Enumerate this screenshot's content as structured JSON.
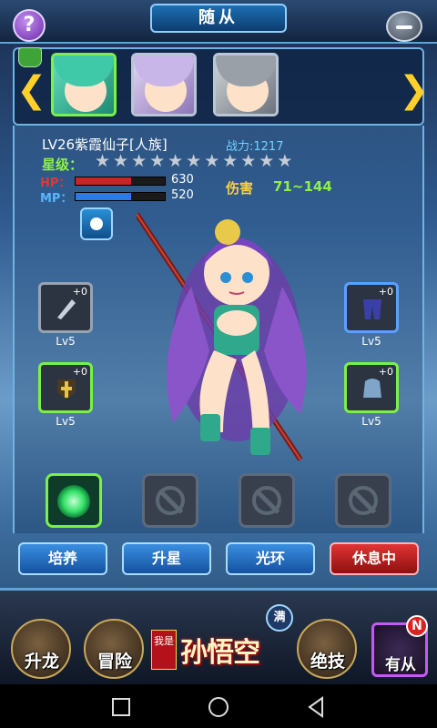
{
  "header": {
    "title": "随从",
    "help_label": "?"
  },
  "roster": {
    "left_arrow": "❮",
    "right_arrow": "❯",
    "portraits": [
      {
        "hair_color": "#3fc9a8",
        "selected": true
      },
      {
        "hair_color": "#c9b6e8",
        "selected": false
      },
      {
        "hair_color": "#9aa0a8",
        "selected": false
      }
    ]
  },
  "companion": {
    "name": "LV26紫霞仙子[人族]",
    "power": "战力:1217",
    "star_label": "星级：",
    "stars": "★★★★★★★★★★★",
    "hp_label": "HP：",
    "hp_value": "630",
    "hp_fraction": 0.62,
    "mp_label": "MP：",
    "mp_value": "520",
    "mp_fraction": 0.62,
    "damage_label": "伤害",
    "damage_value": "71~144"
  },
  "equipment": {
    "weapon": {
      "plus": "+0",
      "level": "Lv5"
    },
    "armor": {
      "plus": "+0",
      "level": "Lv5"
    },
    "amulet": {
      "plus": "+0",
      "level": "Lv5"
    },
    "helmet": {
      "plus": "+0",
      "level": "Lv5"
    }
  },
  "actions": {
    "train": "培养",
    "star_up": "升星",
    "aura": "光环",
    "resting": "休息中"
  },
  "bottom_nav": {
    "dragon": "升龙",
    "adventure": "冒险",
    "logo_small": "我是",
    "logo_name": "孙悟空",
    "full_badge": "满",
    "skill": "绝技",
    "companion": "有从",
    "new_badge": "N"
  },
  "colors": {
    "accent": "#5fa4d9",
    "selected_border": "#7bf04a",
    "resting_button": "#e03434"
  }
}
